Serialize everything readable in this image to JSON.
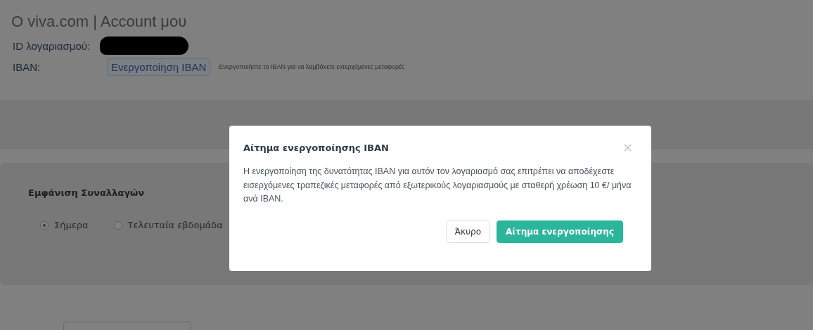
{
  "page": {
    "title": "Ο viva.com | Account μου",
    "account_id_label": "ID λογαριασμού:",
    "iban_label": "IBAN:",
    "iban_button": "Ενεργοποίηση IBAN",
    "iban_hint": "Ενεργοποιήστε το IBAN για να λαμβάνετε εισερχόμενες μεταφορές",
    "transactions": {
      "title": "Εμφάνιση Συναλλαγών",
      "options": [
        {
          "label": "Σήμερα",
          "selected": true
        },
        {
          "label": "Τελευταία εβδομάδα",
          "selected": false
        }
      ]
    }
  },
  "dialog": {
    "title": "Αίτημα ενεργοποίησης IBAN",
    "close": "×",
    "body": "Η ενεργοποίηση της δυνατότητας IBAN για αυτόν τον λογαριασμό σας επιτρέπει να αποδέχεστε εισερχόμενες τραπεζικές μεταφορές από εξωτερικούς λογαριασμούς με σταθερή χρέωση 10 €/ μήνα ανά IBAN.",
    "buttons": [
      {
        "label": "Άκυρο",
        "kind": "secondary"
      },
      {
        "label": "Αίτημα ενεργοποίησης",
        "kind": "primary"
      }
    ]
  }
}
